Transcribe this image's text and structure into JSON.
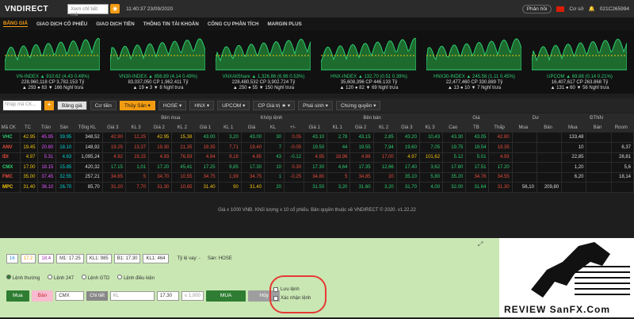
{
  "header": {
    "logo": "VNDIRECT",
    "search_placeholder": "Xem chỉ tiết mã",
    "clock": "11:40:37 23/09/2020",
    "feedback": "Phản hồi",
    "base": "Cơ sở",
    "account": "021C265994"
  },
  "menu": [
    "BẢNG GIÁ",
    "GIAO DỊCH CỔ PHIẾU",
    "GIAO DỊCH TIỀN",
    "THÔNG TIN TÀI KHOẢN",
    "CÔNG CỤ PHÂN TÍCH",
    "MARGIN PLUS"
  ],
  "indices": [
    {
      "name": "VN-INDEX ▲ 910.62 (4.43 0.49%)",
      "vol": "228,960,118 CP 3,782.153 Tỷ",
      "stat": "▲ 293 ● 63 ▼ 166 Nghỉ trưa"
    },
    {
      "name": "VN30-INDEX ▲ 856.89 (4.14 0.49%)",
      "vol": "83,037,050 CP 1,962.411 Tỷ",
      "stat": "▲ 19 ● 3 ▼ 8 Nghỉ trưa"
    },
    {
      "name": "VNXAllShare ▲ 1,326.86 (6.96 0.53%)",
      "vol": "228,480,532 CP 3,902.724 Tỷ",
      "stat": "▲ 250 ● 55 ▼ 150 Nghỉ trưa"
    },
    {
      "name": "HNX-INDEX ▲ 132.70 (0.51 0.39%)",
      "vol": "35,608,396 CP 446.133 Tỷ",
      "stat": "▲ 120 ● 82 ▼ 69 Nghỉ trưa"
    },
    {
      "name": "HNX30-INDEX ▲ 245.58 (1.11 0.45%)",
      "vol": "22,477,460 CP 330.889 Tỷ",
      "stat": "▲ 13 ● 10 ▼ 7 Nghỉ trưa"
    },
    {
      "name": "UPCOM ▲ 69.88 (0.14 0.21%)",
      "vol": "16,407,617 CP 263.868 Tỷ",
      "stat": "▲ 131 ● 60 ▼ 56 Nghỉ trưa"
    }
  ],
  "toolbar": {
    "code_placeholder": "Nhập mã CK...",
    "board": "Bảng giá",
    "base": "Cơ tiền",
    "sector": "Thủy Sản ▾",
    "hose": "HOSE ▾",
    "hnx": "HNX ▾",
    "upcom": "UPCOM ▾",
    "cp": "CP Giá trị ★ ▾",
    "deriv": "Phái sinh ▾",
    "cert": "Chứng quyền ▾"
  },
  "table": {
    "groups": [
      "Bên mua",
      "Khớp lệnh",
      "Bên bán",
      "Giá",
      "Dư",
      "ĐTNN"
    ],
    "headers": [
      "Mã CK",
      "TC",
      "Trần",
      "Sàn",
      "Tổng KL",
      "Giá 3",
      "KL 3",
      "Giá 2",
      "KL 2",
      "Giá 1",
      "KL 1",
      "Giá",
      "KL",
      "+/-",
      "Giá 1",
      "KL 1",
      "Giá 2",
      "KL 2",
      "Giá 3",
      "KL 3",
      "Cao",
      "TB",
      "Thấp",
      "Mua",
      "Bán",
      "Mua",
      "Bán",
      "Room"
    ],
    "rows": [
      [
        "VHC",
        "42.95",
        "45.95",
        "39.95",
        "348,52",
        "42.90",
        "12,25",
        "42.95",
        "15,38",
        "43.00",
        "3,20",
        "43.00",
        "30",
        "0.05",
        "43.10",
        "2,78",
        "43.15",
        "2,85",
        "43.20",
        "10,43",
        "43.30",
        "43.05",
        "42.80",
        "",
        "",
        "133,48",
        "",
        ""
      ],
      [
        "ANV",
        "19.45",
        "20.80",
        "18.10",
        "148,92",
        "19.25",
        "13,37",
        "19.30",
        "21,35",
        "19.35",
        "7,71",
        "19.40",
        "7",
        "-0.05",
        "19.50",
        "44",
        "19.55",
        "7,94",
        "19.60",
        "7,05",
        "19.75",
        "19.54",
        "19.35",
        "",
        "",
        "10",
        "",
        "6,37"
      ],
      [
        "IDI",
        "4.97",
        "5.31",
        "4.63",
        "1,095,24",
        "4.92",
        "19,15",
        "4.93",
        "76,59",
        "4.94",
        "9,18",
        "4.85",
        "43",
        "-0.12",
        "4.95",
        "18,96",
        "4.96",
        "17,00",
        "4.97",
        "101,62",
        "5.12",
        "5.01",
        "4.93",
        "",
        "",
        "22,85",
        "",
        "28,81"
      ],
      [
        "CMX",
        "17.00",
        "18.15",
        "15.85",
        "420,32",
        "17.15",
        "1,01",
        "17.20",
        "45,41",
        "17.25",
        "9,85",
        "17.30",
        "10",
        "0.30",
        "17.30",
        "4,64",
        "17.35",
        "12,66",
        "17.40",
        "3,62",
        "17.80",
        "17.51",
        "17.20",
        "",
        "",
        "1,20",
        "",
        "5,6"
      ],
      [
        "FMC",
        "35.00",
        "37.45",
        "32.55",
        "257,21",
        "34.65",
        "5",
        "34.70",
        "10,55",
        "34.75",
        "1,99",
        "34.75",
        "1",
        "-0.25",
        "34.80",
        "5",
        "34.85",
        "20",
        "35.10",
        "5,80",
        "35.20",
        "34.76",
        "34.55",
        "",
        "",
        "6,20",
        "",
        "18,14"
      ],
      [
        "MPC",
        "31.40",
        "36.10",
        "26.70",
        "85,70",
        "31.20",
        "7,70",
        "31.30",
        "10,85",
        "31.40",
        "90",
        "31.40",
        "20",
        "",
        "31.50",
        "3,20",
        "31.60",
        "3,20",
        "31.70",
        "4,00",
        "32.00",
        "31.64",
        "31.30",
        "56,10",
        "209,80",
        "",
        "",
        ""
      ]
    ]
  },
  "footer": "Giá x 1000 VNĐ. Khối lượng x 10 cổ phiếu. Bản quyền thuộc về VNDIRECT © 2020. v1.22.22",
  "order": {
    "c1": "16",
    "c2": "17.2",
    "c3": "18.4",
    "m1": "M1: 17.25",
    "kl1": "KL1: 985",
    "b1": "B1: 17.30",
    "kl1b": "KL1: 464",
    "margin": "Tỷ lệ vay: -",
    "floor": "Sàn: HOSE",
    "types": [
      "Lệnh thường",
      "Lệnh 247",
      "Lệnh GTD",
      "Lệnh điều kiện"
    ],
    "buy": "Mua",
    "sell": "Bán",
    "symbol": "CMX",
    "detail": "Chi tiết",
    "qty_placeholder": "KL",
    "price": "17.30",
    "max": "≤ 1,000",
    "submit": "MUA",
    "cancel": "Hủy",
    "save_order": "Lưu lệnh",
    "confirm": "Xác nhận lệnh"
  },
  "watermark": "REVIEW SanFX.Com"
}
